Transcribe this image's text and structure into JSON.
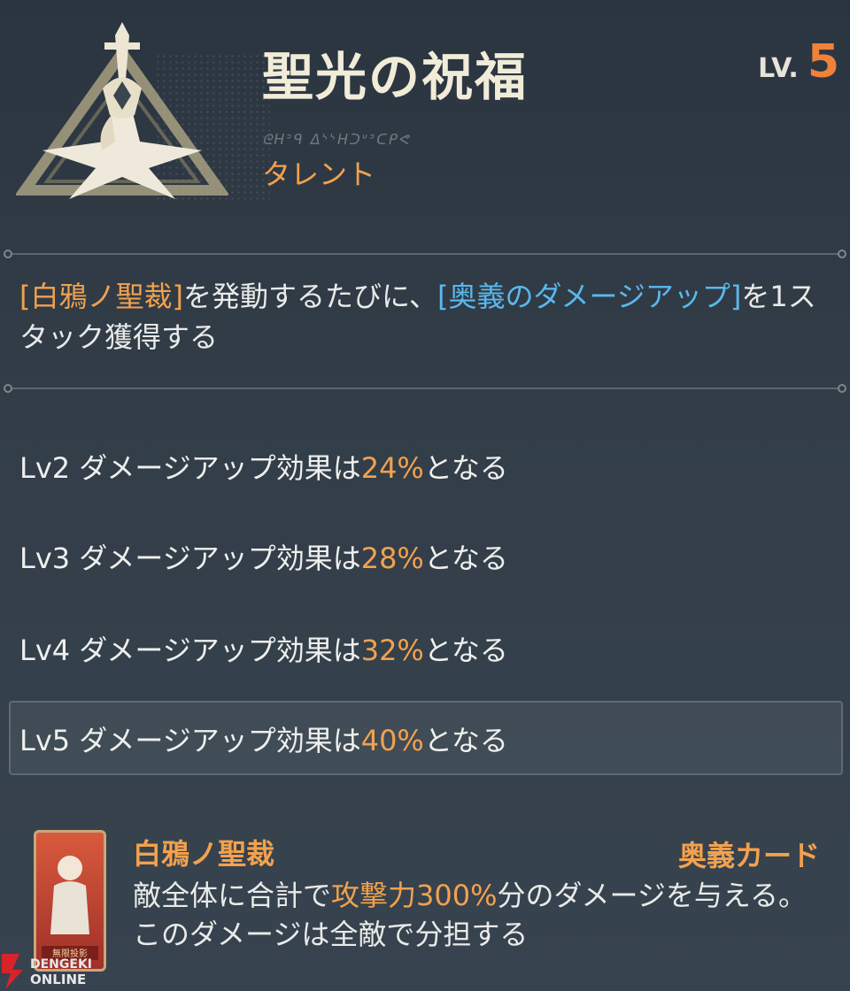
{
  "skill": {
    "title": "聖光の祝福",
    "level_label": "LV.",
    "level_value": "5",
    "rune_text": "ᘓᕼᐣᑫ ᐃᔅᔅᕼᑐᐡᐣᑕᑭᕙ",
    "type": "タレント"
  },
  "description": {
    "parts": [
      {
        "text": "[白鴉ノ聖裁]",
        "style": "orange"
      },
      {
        "text": "を発動するたびに、",
        "style": "normal"
      },
      {
        "text": "[奥義のダメージアップ]",
        "style": "blue"
      },
      {
        "text": "を1スタック獲得する",
        "style": "normal"
      }
    ]
  },
  "level_effects": [
    {
      "prefix": "Lv2 ダメージアップ効果は",
      "value": "24%",
      "suffix": "となる"
    },
    {
      "prefix": "Lv3 ダメージアップ効果は",
      "value": "28%",
      "suffix": "となる"
    },
    {
      "prefix": "Lv4 ダメージアップ効果は",
      "value": "32%",
      "suffix": "となる"
    },
    {
      "prefix": "Lv5 ダメージアップ効果は",
      "value": "40%",
      "suffix": "となる"
    }
  ],
  "current_level_index": 3,
  "linked_card": {
    "name": "白鴉ノ聖裁",
    "type": "奥義カード",
    "desc_a": "敵全体に合計で",
    "desc_highlight": "攻撃力300%",
    "desc_b": "分のダメージを与える。このダメージは全敵で分担する",
    "card_badge": "無限投影"
  },
  "watermark": {
    "line1": "DENGEKI",
    "line2": "ONLINE"
  },
  "colors": {
    "accent_orange": "#f2a14e",
    "level_orange": "#f0813a",
    "keyword_blue": "#5ab8ee"
  }
}
